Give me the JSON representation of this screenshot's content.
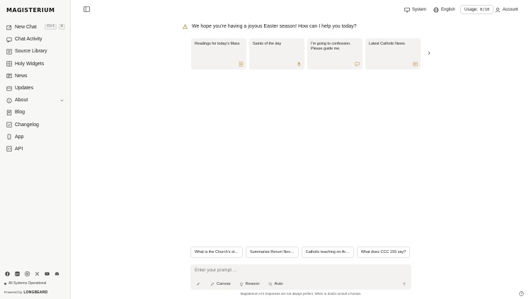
{
  "app": {
    "logo": "MAGISTERIUM"
  },
  "sidebar": {
    "items": [
      {
        "label": "New Chat",
        "icon": "edit-icon",
        "shortcut": [
          "Ctrl",
          "K"
        ]
      },
      {
        "label": "Chat Activity",
        "icon": "chat-icon"
      },
      {
        "label": "Source Library",
        "icon": "library-icon"
      },
      {
        "label": "Holy Widgets",
        "icon": "widgets-icon"
      },
      {
        "label": "News",
        "icon": "news-icon"
      },
      {
        "label": "Updates",
        "icon": "updates-icon"
      },
      {
        "label": "About",
        "icon": "info-icon"
      },
      {
        "label": "Blog",
        "icon": "blog-icon"
      },
      {
        "label": "Changelog",
        "icon": "changelog-icon"
      },
      {
        "label": "App",
        "icon": "phone-icon"
      },
      {
        "label": "API",
        "icon": "code-icon"
      }
    ],
    "socials": [
      "facebook-icon",
      "linkedin-icon",
      "instagram-icon",
      "x-icon",
      "youtube-icon",
      "discord-icon"
    ],
    "status": "All Systems Operational",
    "powered_by": "Powered by",
    "powered_brand": "LONGBEARD"
  },
  "header": {
    "theme": "System",
    "language": "English",
    "usage_label": "Usage:",
    "usage_value": "0/10",
    "account": "Account"
  },
  "main": {
    "greeting": "We hope you’re having a joyous Easter season! How can I help you today?",
    "cards": [
      {
        "text": "Readings for today’s Mass",
        "icon": "book-icon"
      },
      {
        "text": "Saints of the day",
        "icon": "hand-icon"
      },
      {
        "text": "I’m going to confession. Please guide me.",
        "icon": "speech-icon"
      },
      {
        "text": "Latest Catholic News",
        "icon": "news-icon"
      }
    ],
    "suggestions": [
      "What is the Church’s st…",
      "Summarize Rerum Nov…",
      "Catholic teaching on Ar…",
      "What does CCC 155 say?"
    ],
    "prompt": {
      "placeholder": "Enter your prompt ...",
      "tools": {
        "canvas": "Canvas",
        "reason": "Reason",
        "auto": "Auto"
      }
    },
    "disclaimer": "Magisterium AI’s responses are not always perfect. When in doubt consult a human."
  }
}
